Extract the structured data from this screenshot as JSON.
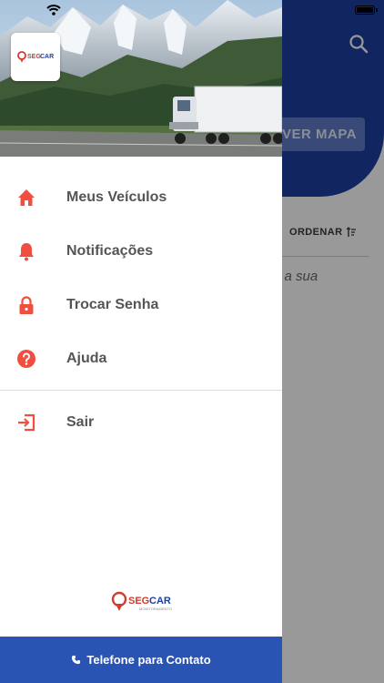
{
  "background_app": {
    "map_button_label": "VER MAPA",
    "sort_label": "ORDENAR",
    "hint_text": "u a sua"
  },
  "drawer": {
    "logo_text": "SEGCAR",
    "logo_subtext": "MONITORAMENTO",
    "menu_items": [
      {
        "label": "Meus Veículos",
        "icon": "home-icon"
      },
      {
        "label": "Notificações",
        "icon": "bell-icon"
      },
      {
        "label": "Trocar Senha",
        "icon": "lock-icon"
      },
      {
        "label": "Ajuda",
        "icon": "help-icon"
      }
    ],
    "logout_label": "Sair",
    "contact_label": "Telefone para Contato"
  },
  "colors": {
    "accent": "#f04e3e",
    "brand_blue": "#1d3fa0",
    "contact_bar": "#2a54b3",
    "menu_text": "#555555"
  }
}
